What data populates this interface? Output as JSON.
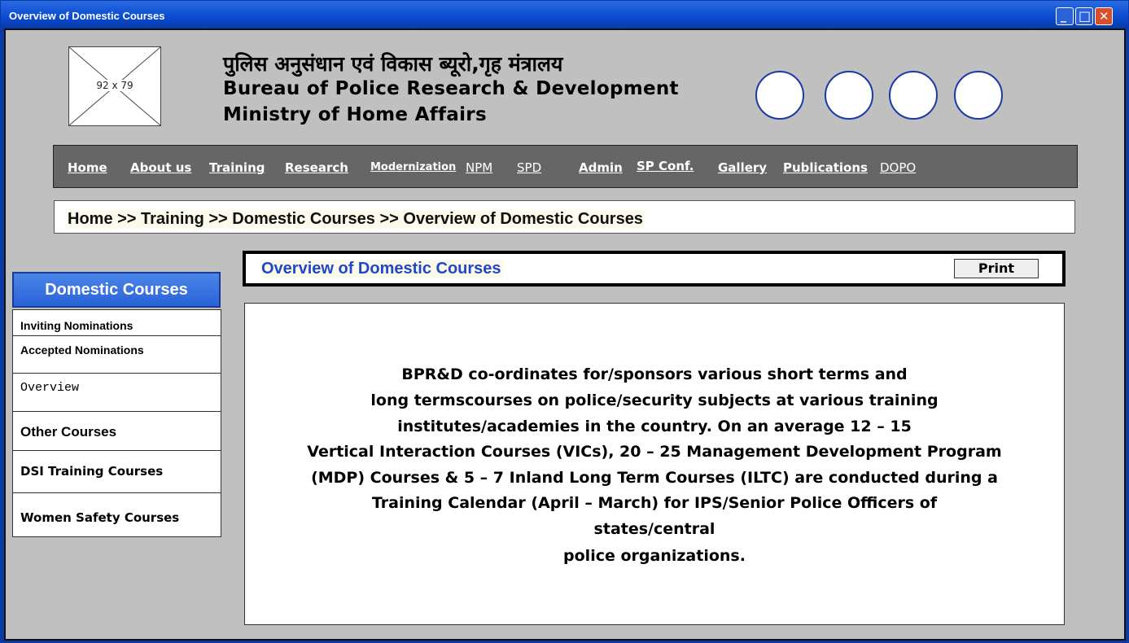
{
  "window": {
    "title": "Overview of Domestic Courses",
    "min_glyph": "_",
    "max_glyph": "□",
    "close_glyph": "✕"
  },
  "header": {
    "logo_placeholder": "92 x 79",
    "org_hindi": "पुलिस अनुसंधान एवं विकास ब्यूरो,गृह मंत्रालय",
    "org_english": "Bureau of Police Research & Development",
    "ministry": "Ministry of Home Affairs"
  },
  "nav": {
    "items": [
      "Home",
      "About us",
      "Training",
      "Research",
      "Modernization",
      "NPM",
      "SPD",
      "Admin",
      "SP Conf.",
      "Gallery",
      "Publications",
      "DOPO"
    ]
  },
  "breadcrumb": {
    "text": "Home  >> Training >> Domestic Courses >> Overview of Domestic Courses"
  },
  "sidebar": {
    "title": "Domestic Courses",
    "items": [
      "Inviting Nominations",
      "Accepted Nominations",
      "Overview",
      "Other Courses",
      "DSI Training Courses",
      "Women Safety Courses"
    ]
  },
  "content": {
    "title": "Overview of Domestic Courses",
    "print_label": "Print",
    "lines": [
      "BPR&D co-ordinates for/sponsors various short terms and",
      "long termscourses on police/security subjects at various training",
      "institutes/academies in the country. On an average 12 – 15",
      "Vertical Interaction Courses (VICs), 20 – 25 Management Development Program",
      "(MDP) Courses & 5 – 7 Inland Long Term Courses (ILTC) are conducted during a",
      "Training Calendar (April – March) for IPS/Senior Police Officers of",
      "states/central",
      "police organizations."
    ]
  },
  "colors": {
    "titlebar": "#0a4bd2",
    "sidebar_header": "#2a62d8",
    "content_title": "#2246c8",
    "navbar": "#666666",
    "background": "#c0c0c0"
  }
}
